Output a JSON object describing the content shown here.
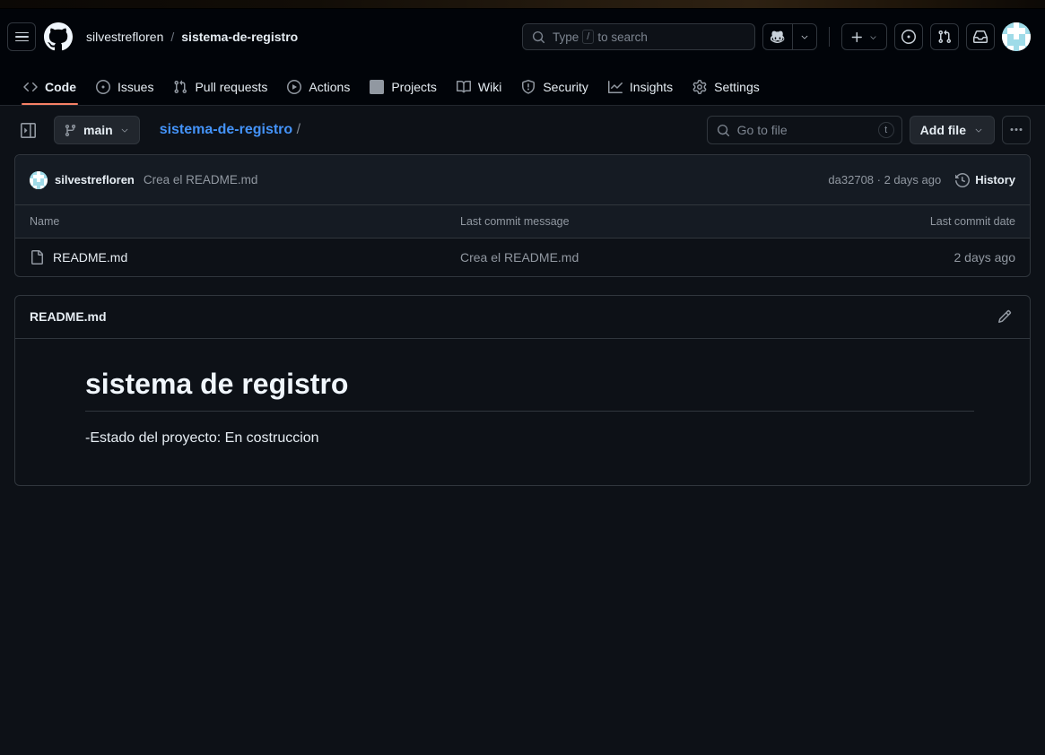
{
  "header": {
    "hamburger_icon": "hamburger-menu-icon",
    "logo_icon": "github-logo-icon",
    "owner": "silvestrefloren",
    "separator": "/",
    "repo": "sistema-de-registro",
    "search": {
      "placeholder_before": "Type",
      "slash_key": "/",
      "placeholder_after": "to search",
      "icon": "search-icon"
    },
    "copilot_icon": "copilot-icon",
    "copilot_caret": "chevron-down-icon",
    "create_new_icon": "plus-icon",
    "create_new_caret": "chevron-down-icon",
    "issues_icon": "issue-opened-icon",
    "pull_requests_icon": "git-pull-request-icon",
    "inbox_icon": "inbox-icon",
    "avatar": "user-avatar"
  },
  "repo_nav": {
    "items": [
      {
        "label": "Code",
        "icon": "code-icon",
        "active": true
      },
      {
        "label": "Issues",
        "icon": "issue-opened-icon",
        "active": false
      },
      {
        "label": "Pull requests",
        "icon": "git-pull-request-icon",
        "active": false
      },
      {
        "label": "Actions",
        "icon": "play-icon",
        "active": false
      },
      {
        "label": "Projects",
        "icon": "table-icon",
        "active": false
      },
      {
        "label": "Wiki",
        "icon": "book-icon",
        "active": false
      },
      {
        "label": "Security",
        "icon": "shield-icon",
        "active": false
      },
      {
        "label": "Insights",
        "icon": "graph-icon",
        "active": false
      },
      {
        "label": "Settings",
        "icon": "gear-icon",
        "active": false
      }
    ]
  },
  "file_nav": {
    "sidebar_toggle_icon": "sidebar-expand-icon",
    "branch": "main",
    "branch_icon": "git-branch-icon",
    "branch_caret": "chevron-down-icon",
    "breadcrumb_repo": "sistema-de-registro",
    "breadcrumb_slash": "/",
    "go_to_file_placeholder": "Go to file",
    "go_to_file_icon": "search-icon",
    "go_to_file_key": "t",
    "add_file_label": "Add file",
    "add_file_caret": "chevron-down-icon",
    "more_options_icon": "kebab-horizontal-icon"
  },
  "commit_bar": {
    "author": "silvestrefloren",
    "message": "Crea el README.md",
    "sha_and_time": "da32708 · 2 days ago",
    "history_label": "History",
    "history_icon": "history-icon"
  },
  "file_table": {
    "columns": [
      "Name",
      "Last commit message",
      "Last commit date"
    ],
    "rows": [
      {
        "icon": "file-icon",
        "name": "README.md",
        "commit_message": "Crea el README.md",
        "commit_date": "2 days ago"
      }
    ]
  },
  "readme": {
    "title": "README.md",
    "edit_icon": "pencil-icon",
    "heading": "sistema de registro",
    "paragraph": "-Estado del proyecto: En costruccion"
  },
  "colors": {
    "page_bg": "#0d1117",
    "header_bg": "#010409",
    "panel_header_bg": "#151b23",
    "border": "#30363d",
    "accent_link": "#4493f8",
    "active_tab_underline": "#f78166",
    "muted_text": "#9198a1",
    "avatar_accent": "#9fdbe8"
  }
}
